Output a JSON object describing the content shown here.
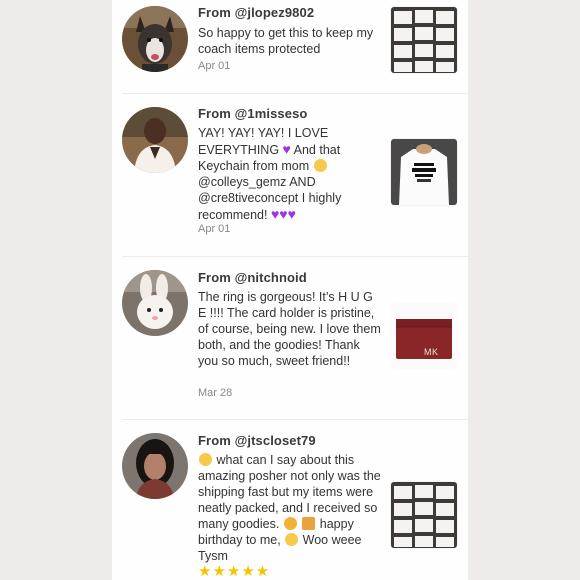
{
  "reviews": [
    {
      "from": "From @jlopez9802",
      "text": "So happy to get this to keep my coach items protected",
      "date": "Apr 01"
    },
    {
      "from": "From @1misseso",
      "text_1": "YAY! YAY! YAY! I LOVE EVERYTHING",
      "text_2": "And that Keychain from mom",
      "text_3": "@colleys_gemz AND @cre8tiveconcept I highly recommend!",
      "date": "Apr 01"
    },
    {
      "from": "From @nitchnoid",
      "text": "The ring is gorgeous! It’s H U G E !!!! The card holder is pristine, of course, being new. I love them both, and the goodies! Thank you so much, sweet friend!!",
      "date": "Mar 28",
      "thumb_label": "MK"
    },
    {
      "from": "From @jtscloset79",
      "text_1": "what can I say about this amazing posher not only was the shipping fast but my items were neatly packed, and I received so many goodies.",
      "text_2": "happy birthday to me,",
      "text_3": "Woo weee Tysm",
      "stars": "★★★★★"
    }
  ],
  "colors": {
    "heart": "#9b34e8",
    "star": "#f5c400",
    "card_holder": "#8a2528"
  },
  "icons": [
    "purple-heart-icon",
    "crying-face-icon",
    "heart-eyes-face-icon",
    "party-face-icon",
    "party-popper-icon",
    "smiling-face-icon",
    "star-icon"
  ]
}
